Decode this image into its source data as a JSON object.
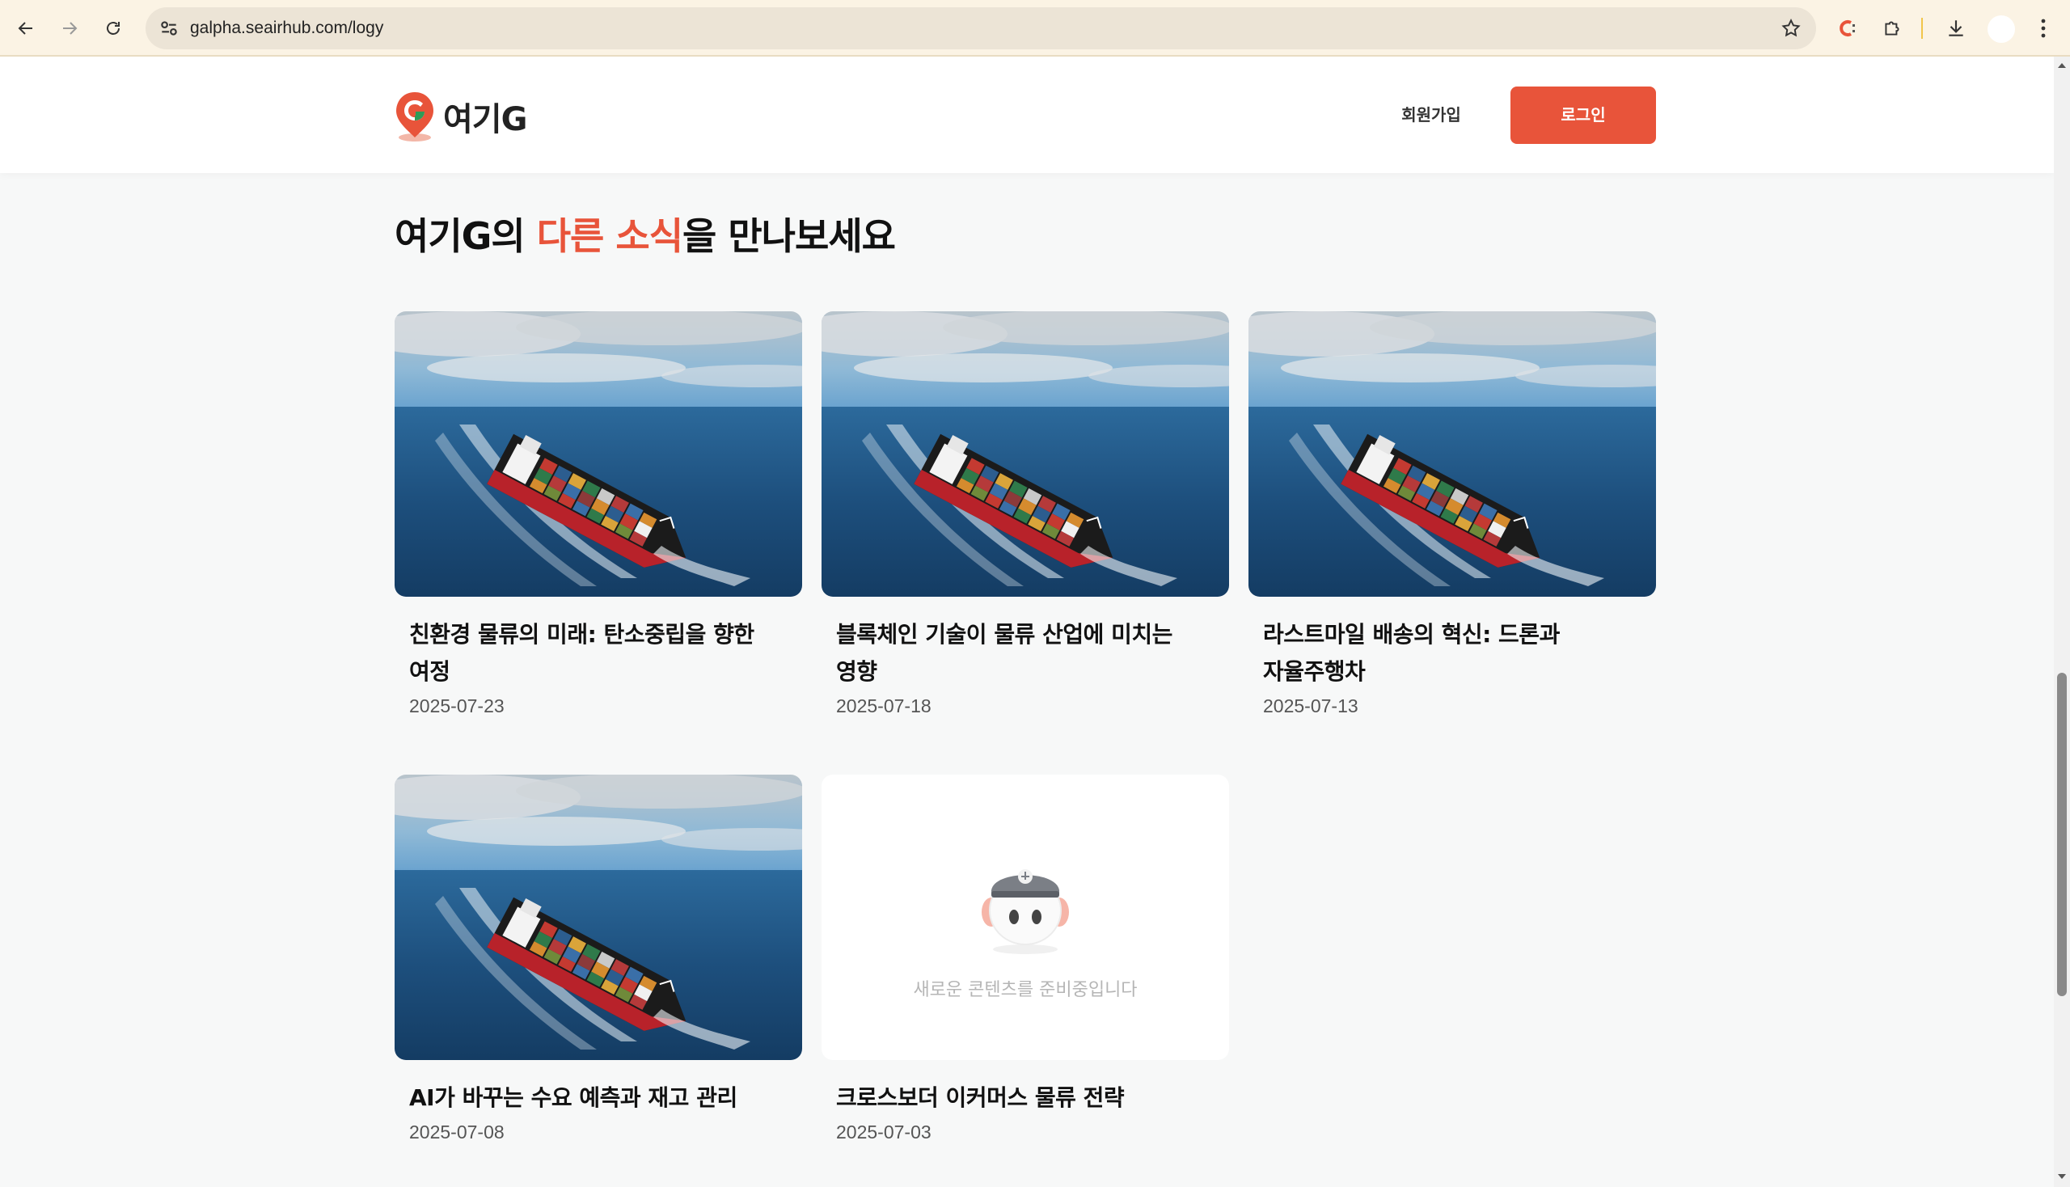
{
  "browser": {
    "url": "galpha.seairhub.com/logy"
  },
  "header": {
    "logo_text": "여기G",
    "signup_label": "회원가입",
    "login_label": "로그인"
  },
  "section": {
    "title_prefix": "여기G의 ",
    "title_accent": "다른 소식",
    "title_suffix": "을 만나보세요"
  },
  "cards": [
    {
      "title_line1": "친환경 물류의 미래: 탄소중립을 향한",
      "title_line2": "여정",
      "date": "2025-07-23"
    },
    {
      "title_line1": "블록체인 기술이 물류 산업에 미치는",
      "title_line2": "영향",
      "date": "2025-07-18"
    },
    {
      "title_line1": "라스트마일 배송의 혁신: 드론과",
      "title_line2": "자율주행차",
      "date": "2025-07-13"
    },
    {
      "title_line1": "AI가 바꾸는 수요 예측과 재고 관리",
      "title_line2": "",
      "date": "2025-07-08"
    },
    {
      "title_line1": "크로스보더 이커머스 물류 전략",
      "title_line2": "",
      "date": "2025-07-03",
      "placeholder_text": "새로운 콘텐츠를 준비중입니다"
    }
  ],
  "colors": {
    "accent": "#e8543a"
  }
}
